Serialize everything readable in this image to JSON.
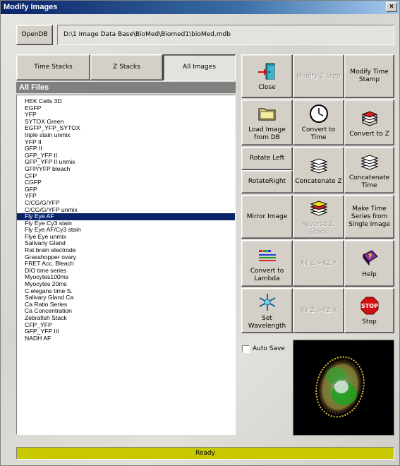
{
  "window": {
    "title": "Modify Images",
    "close_glyph": "×"
  },
  "db": {
    "open_label": "OpenDB",
    "path": "D:\\1 Image Data Base\\BioMed\\Biomed1\\bioMed.mdb"
  },
  "tabs": [
    {
      "label": "Time Stacks"
    },
    {
      "label": "Z Stacks"
    },
    {
      "label": "All Images",
      "active": true
    }
  ],
  "list": {
    "header": "All Files",
    "selected_index": 17,
    "items": [
      "HEK Cells 3D",
      "EGFP",
      "YFP",
      "SYTOX Green",
      "EGFP_YFP_SYTOX",
      "triple stain unmix",
      " YFP II",
      "GFP II",
      "GFP_YFP II",
      "GFP_YFP II unmix",
      "GFP/YFP bleach",
      "CFP",
      "CGFP",
      "GFP",
      "YFP",
      "C/CG/G/YFP",
      "C/CG/G/YFP unmix",
      "Fly Eye AF",
      "Fly Eye Cy3 stain",
      "Fly Eye AF/Cy3 stain",
      "Flye Eye unmix",
      "Salivariy Gland",
      "Rat brain electrode",
      "Grasshopper ovary",
      "FRET Acc. Bleach",
      "DIO time series",
      "Myocytes100ms",
      "Myocytes 20ms",
      "C.elegans time S.",
      "Salivary Gland Ca",
      "Ca Ratio Series",
      "Ca Concentration",
      "Zebrafish Stack",
      "CFP_YFP",
      "GFP_YFP III",
      "NADH AF"
    ]
  },
  "buttons": {
    "close": "Close",
    "modify_z_step": "Modify Z Step",
    "modify_time_stamp": "Modify Time Stamp",
    "load_image": "Load Image from DB",
    "convert_to_time": "Convert to Time",
    "convert_to_z": "Convert  to Z",
    "rotate_left": "Rotate Left",
    "rotate_right": "RotateRight",
    "concatenate_z": "Concatenate Z",
    "concatenate_time": "Concatenate Time",
    "mirror_image": "Mirror Image",
    "reverse_z_stack": "Reverse Z-Stack",
    "make_time_series": "Make Time Series from Single Image",
    "convert_to_lambda": "Convert to Lambda",
    "xy_to_xzy": "XY Z->XZ Y",
    "help": "Help",
    "set_wavelength": "Set Wavelength",
    "xy_to_yzx": "XY Z->YZ X",
    "stop": "Stop",
    "stop_sign_text": "STOP"
  },
  "autosave": {
    "label": "Auto Save",
    "checked": false
  },
  "status": {
    "text": "Ready",
    "color": "#c8c800"
  },
  "icons": [
    "door-exit-icon",
    "clock-icon",
    "folder-icon",
    "stack-red-icon",
    "stack-icon",
    "stack-reverse-icon",
    "spectrum-icon",
    "help-book-icon",
    "snowflake-icon",
    "stop-sign-icon"
  ]
}
